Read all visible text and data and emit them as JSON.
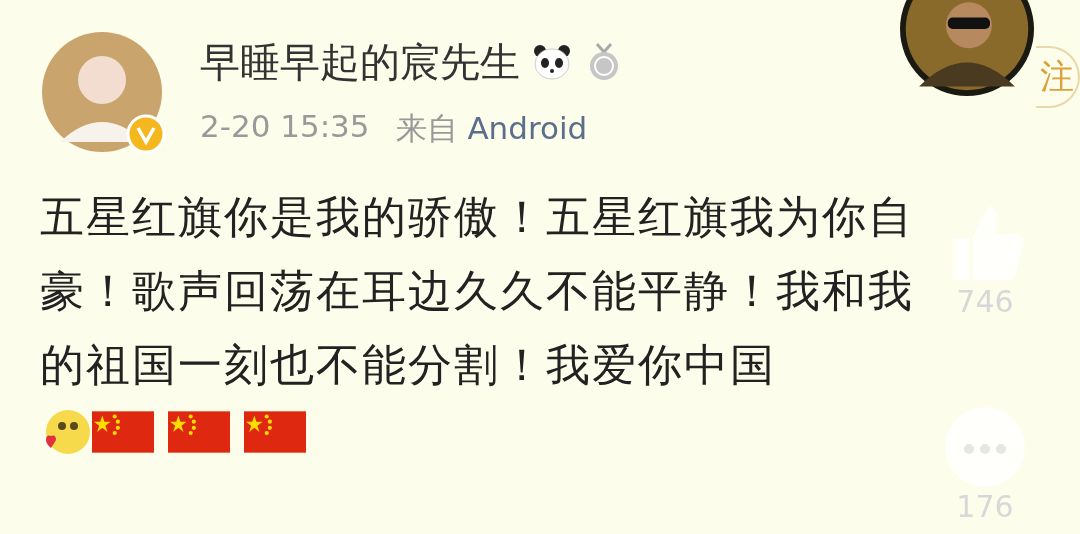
{
  "post": {
    "author": "早睡早起的宸先生",
    "verified": true,
    "time": "2-20 15:35",
    "source_label": "来自",
    "source": "Android",
    "text": "五星红旗你是我的骄傲！五星红旗我为你自豪！歌声回荡在耳边久久不能平静！我和我的祖国一刻也不能分割！我爱你中国",
    "emojis": [
      {
        "kind": "face"
      },
      {
        "kind": "flag"
      },
      {
        "kind": "flag"
      },
      {
        "kind": "flag"
      }
    ]
  },
  "follow_button": {
    "label": "注"
  },
  "actions": [
    {
      "kind": "like",
      "count": "746"
    },
    {
      "kind": "comment",
      "count": "176"
    }
  ]
}
